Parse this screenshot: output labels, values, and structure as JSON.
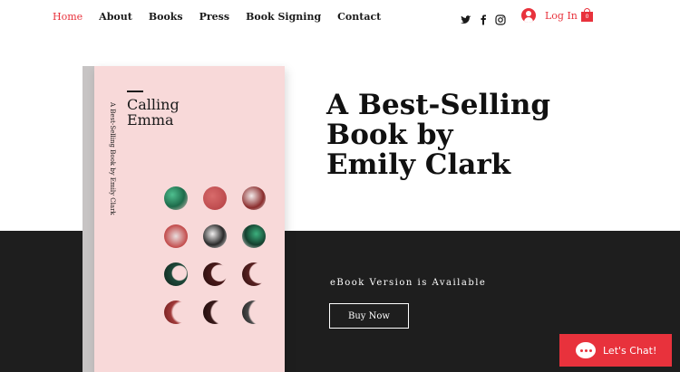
{
  "nav": {
    "items": [
      {
        "label": "Home",
        "active": true
      },
      {
        "label": "About"
      },
      {
        "label": "Books"
      },
      {
        "label": "Press"
      },
      {
        "label": "Book Signing"
      },
      {
        "label": "Contact"
      }
    ]
  },
  "social": {
    "icons": [
      "twitter-icon",
      "facebook-icon",
      "instagram-icon"
    ]
  },
  "account": {
    "login_label": "Log In",
    "cart_count": "0"
  },
  "book": {
    "cover_title_line1": "Calling",
    "cover_title_line2": "Emma",
    "cover_subtitle": "A Best-Selling Book by Emily Clark"
  },
  "hero": {
    "title_line1": "A Best-Selling",
    "title_line2": "Book by",
    "title_line3": "Emily Clark",
    "availability": "eBook Version is Available",
    "cta_label": "Buy Now"
  },
  "chat": {
    "label": "Let's Chat!"
  },
  "colors": {
    "accent": "#e8323c",
    "dark": "#1e1e1e",
    "cover": "#f8d9d9"
  }
}
